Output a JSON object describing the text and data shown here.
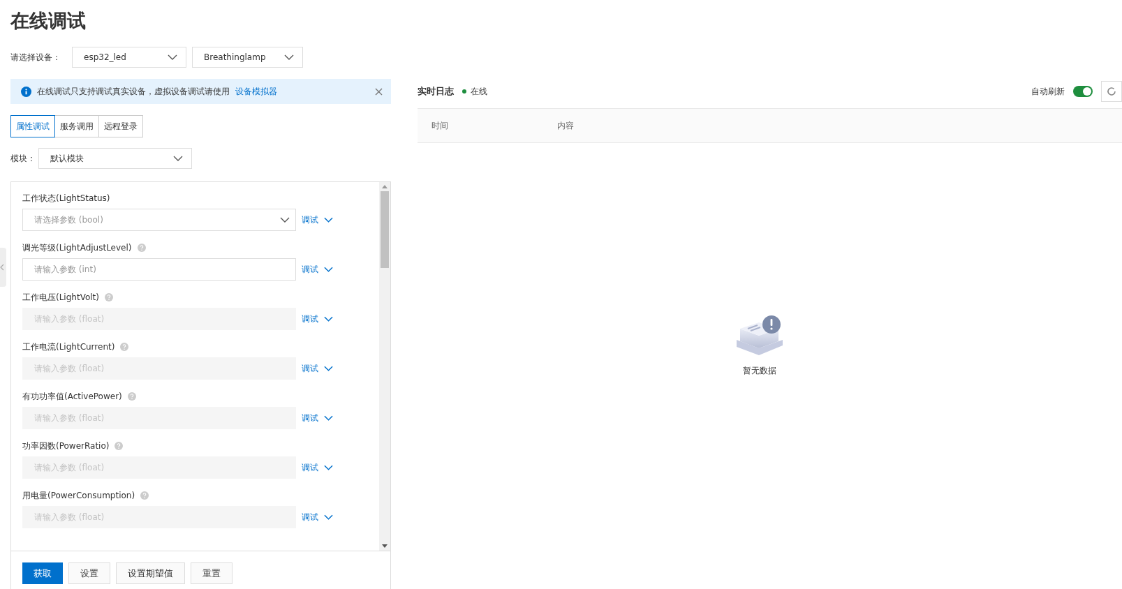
{
  "title": "在线调试",
  "device": {
    "label": "请选择设备：",
    "product": "esp32_led",
    "device": "Breathinglamp"
  },
  "alert": {
    "text": "在线调试只支持调试真实设备，虚拟设备调试请使用",
    "link": "设备模拟器"
  },
  "tabs": [
    {
      "label": "属性调试",
      "selected": true
    },
    {
      "label": "服务调用",
      "selected": false
    },
    {
      "label": "远程登录",
      "selected": false
    }
  ],
  "module": {
    "label": "模块：",
    "value": "默认模块"
  },
  "properties": [
    {
      "label": "工作状态(LightStatus)",
      "kind": "select",
      "placeholder": "请选择参数 (bool)",
      "help": false,
      "disabled": false,
      "action": "调试"
    },
    {
      "label": "调光等级(LightAdjustLevel)",
      "kind": "input",
      "placeholder": "请输入参数 (int)",
      "help": true,
      "disabled": false,
      "action": "调试"
    },
    {
      "label": "工作电压(LightVolt)",
      "kind": "input",
      "placeholder": "请输入参数 (float)",
      "help": true,
      "disabled": true,
      "action": "调试"
    },
    {
      "label": "工作电流(LightCurrent)",
      "kind": "input",
      "placeholder": "请输入参数 (float)",
      "help": true,
      "disabled": true,
      "action": "调试"
    },
    {
      "label": "有功功率值(ActivePower)",
      "kind": "input",
      "placeholder": "请输入参数 (float)",
      "help": true,
      "disabled": true,
      "action": "调试"
    },
    {
      "label": "功率因数(PowerRatio)",
      "kind": "input",
      "placeholder": "请输入参数 (float)",
      "help": true,
      "disabled": true,
      "action": "调试"
    },
    {
      "label": "用电量(PowerConsumption)",
      "kind": "input",
      "placeholder": "请输入参数 (float)",
      "help": true,
      "disabled": true,
      "action": "调试"
    }
  ],
  "buttons": [
    {
      "label": "获取",
      "primary": true
    },
    {
      "label": "设置",
      "primary": false
    },
    {
      "label": "设置期望值",
      "primary": false
    },
    {
      "label": "重置",
      "primary": false
    }
  ],
  "log": {
    "title": "实时日志",
    "status": "在线",
    "online": true,
    "auto_refresh_label": "自动刷新",
    "auto_refresh": true,
    "columns": [
      "时间",
      "内容"
    ],
    "empty": "暂无数据"
  }
}
